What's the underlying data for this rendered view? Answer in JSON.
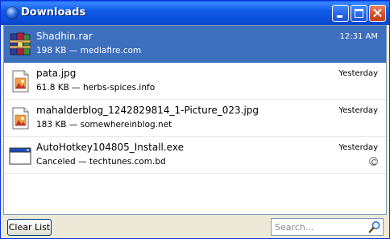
{
  "window": {
    "title": "Downloads"
  },
  "downloads": [
    {
      "name": "Shadhin.rar",
      "status": "198 KB — mediafire.com",
      "time": "12:31 AM",
      "icon": "rar-archive-icon",
      "selected": true
    },
    {
      "name": "pata.jpg",
      "status": "61.8 KB — herbs-spices.info",
      "time": "Yesterday",
      "icon": "image-file-icon"
    },
    {
      "name": "mahalderblog_1242829814_1-Picture_023.jpg",
      "status": "183 KB — somewhereinblog.net",
      "time": "Yesterday",
      "icon": "image-file-icon"
    },
    {
      "name": "AutoHotkey104805_Install.exe",
      "status": "Canceled — techtunes.com.bd",
      "time": "Yesterday",
      "icon": "exe-file-icon",
      "action_icon": "retry-icon"
    }
  ],
  "footer": {
    "clear_label": "Clear List",
    "search_placeholder": "Search..."
  },
  "colors": {
    "titlebar": "#0a4ed8",
    "selection": "#3d6fbf",
    "close_button": "#d6552c",
    "window_bg": "#ece9d8"
  }
}
